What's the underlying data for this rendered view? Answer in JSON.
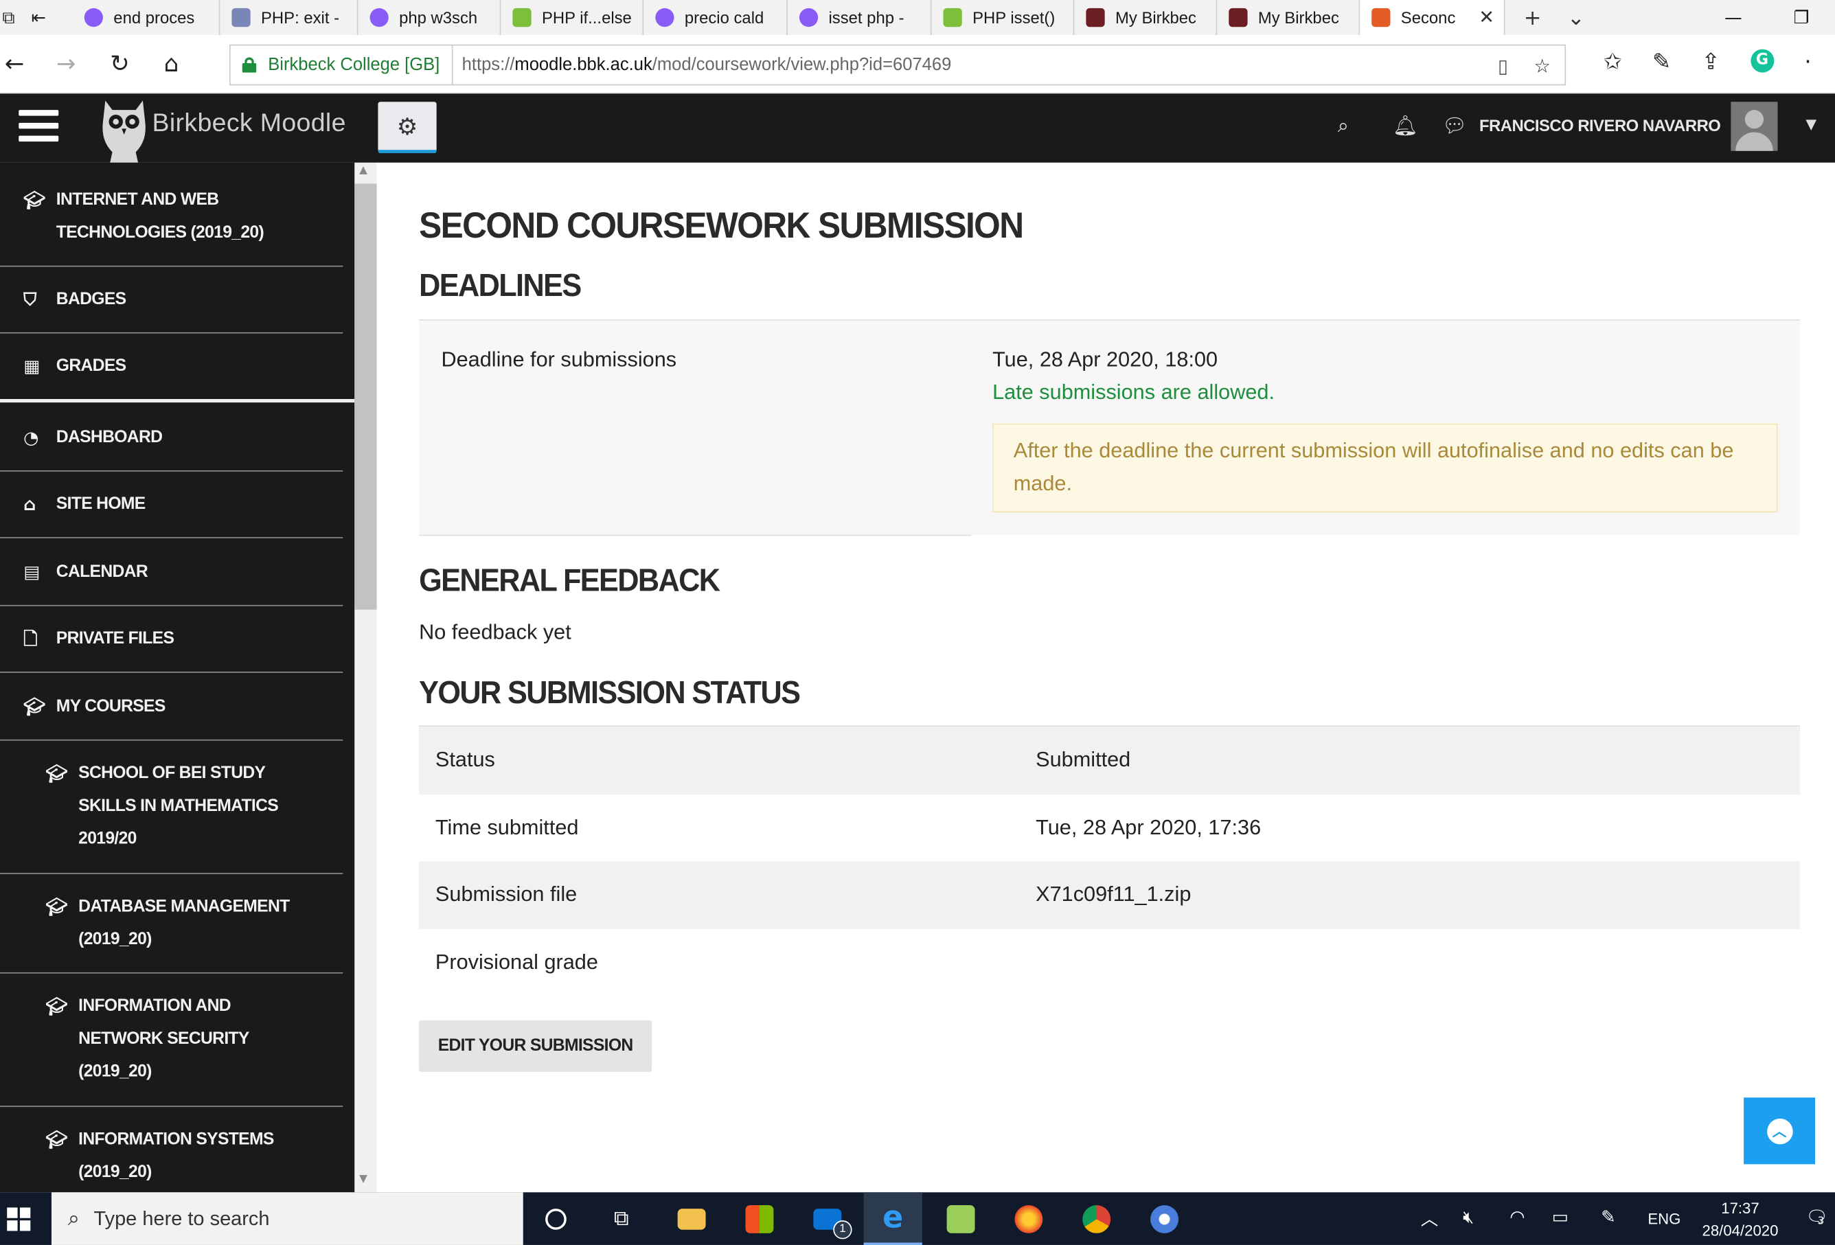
{
  "browser": {
    "tabs": [
      {
        "title": "end proces",
        "favicon_color": "#8a5cf6"
      },
      {
        "title": "PHP: exit -",
        "favicon_color": "#7a86b8"
      },
      {
        "title": "php w3sch",
        "favicon_color": "#8a5cf6"
      },
      {
        "title": "PHP if...else",
        "favicon_color": "#7cbf3a"
      },
      {
        "title": "precio cald",
        "favicon_color": "#8a5cf6"
      },
      {
        "title": "isset php -",
        "favicon_color": "#8a5cf6"
      },
      {
        "title": "PHP isset()",
        "favicon_color": "#7cbf3a"
      },
      {
        "title": "My Birkbec",
        "favicon_color": "#6b1f24"
      },
      {
        "title": "My Birkbec",
        "favicon_color": "#6b1f24"
      },
      {
        "title": "Seconc",
        "favicon_color": "#e45c23"
      }
    ],
    "site_identity": "Birkbeck College [GB]",
    "url_prefix": "https://",
    "url_host": "moodle.bbk.ac.uk",
    "url_path": "/mod/coursework/view.php?id=607469",
    "icons": [
      "back-icon",
      "forward-icon",
      "refresh-icon",
      "home-icon",
      "reading-view-icon",
      "favorite-star-icon",
      "favorites-icon",
      "pen-icon",
      "share-icon",
      "grammarly-icon"
    ]
  },
  "header": {
    "brand": "Birkbeck Moodle",
    "user_name": "FRANCISCO RIVERO NAVARRO"
  },
  "sidebar": {
    "items": [
      {
        "label": "INTERNET AND WEB TECHNOLOGIES (2019_20)",
        "icon": "graduation-cap-icon"
      },
      {
        "label": "BADGES",
        "icon": "shield-icon"
      },
      {
        "label": "GRADES",
        "icon": "table-icon"
      },
      {
        "label": "DASHBOARD",
        "icon": "dashboard-icon"
      },
      {
        "label": "SITE HOME",
        "icon": "home-icon"
      },
      {
        "label": "CALENDAR",
        "icon": "calendar-icon"
      },
      {
        "label": "PRIVATE FILES",
        "icon": "file-icon"
      },
      {
        "label": "MY COURSES",
        "icon": "graduation-cap-icon"
      },
      {
        "label": "SCHOOL OF BEI STUDY SKILLS IN MATHEMATICS 2019/20",
        "icon": "graduation-cap-icon"
      },
      {
        "label": "DATABASE MANAGEMENT (2019_20)",
        "icon": "graduation-cap-icon"
      },
      {
        "label": "INFORMATION AND NETWORK SECURITY (2019_20)",
        "icon": "graduation-cap-icon"
      },
      {
        "label": "INFORMATION SYSTEMS (2019_20)",
        "icon": "graduation-cap-icon"
      }
    ]
  },
  "main": {
    "title": "SECOND COURSEWORK SUBMISSION",
    "deadlines": {
      "heading": "DEADLINES",
      "label": "Deadline for submissions",
      "date": "Tue, 28 Apr 2020, 18:00",
      "late_note": "Late submissions are allowed.",
      "warning": "After the deadline the current submission will autofinalise and no edits can be made."
    },
    "feedback": {
      "heading": "GENERAL FEEDBACK",
      "text": "No feedback yet"
    },
    "submission_status": {
      "heading": "YOUR SUBMISSION STATUS",
      "rows": [
        {
          "key": "Status",
          "value": "Submitted"
        },
        {
          "key": "Time submitted",
          "value": "Tue, 28 Apr 2020, 17:36"
        },
        {
          "key": "Submission file",
          "value": "X71c09f11_1.zip"
        },
        {
          "key": "Provisional grade",
          "value": ""
        }
      ]
    },
    "edit_button": "EDIT YOUR SUBMISSION"
  },
  "taskbar": {
    "search_placeholder": "Type here to search",
    "mail_badge": "1",
    "language": "ENG",
    "time": "17:37",
    "date": "28/04/2020",
    "notification_count": "3"
  }
}
